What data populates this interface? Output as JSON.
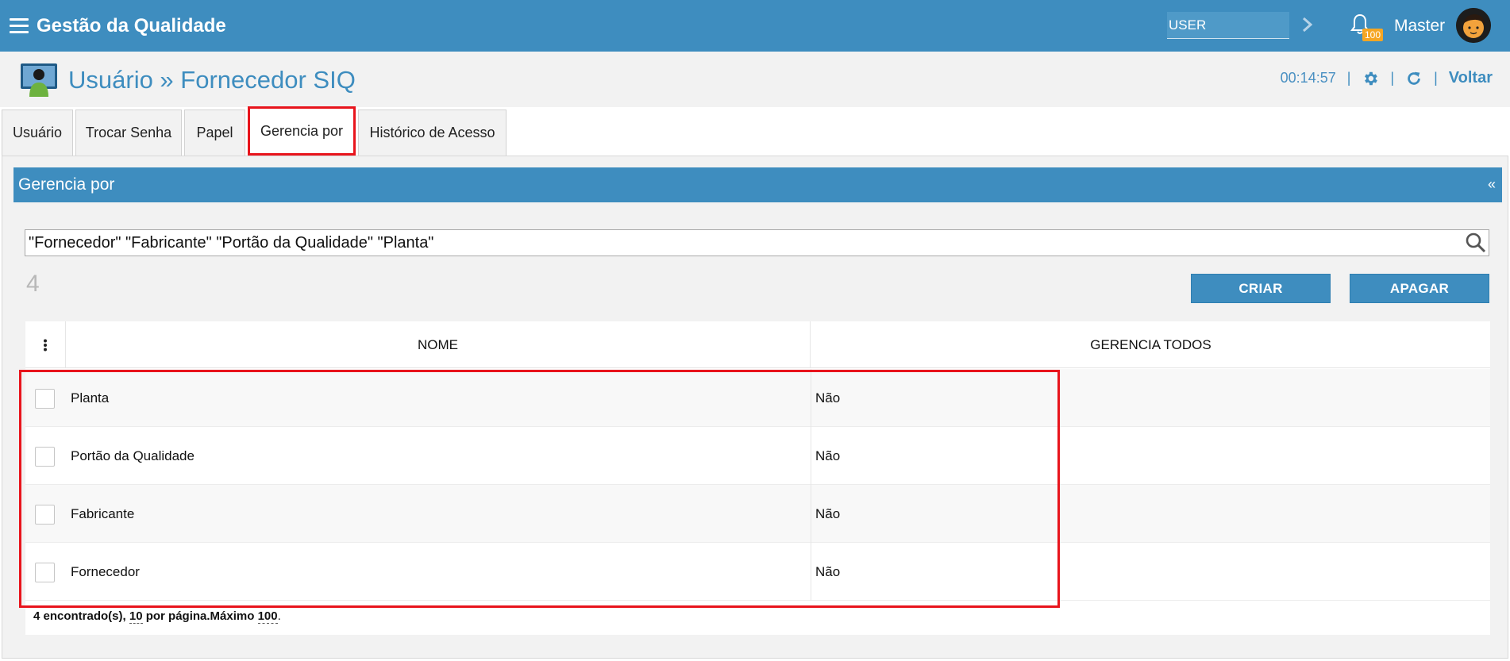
{
  "topbar": {
    "title": "Gestão da Qualidade",
    "user_search_placeholder": "USER",
    "notification_count": "100",
    "user_name": "Master"
  },
  "header": {
    "title": "Usuário » Fornecedor SIQ",
    "timer": "00:14:57",
    "back_label": "Voltar",
    "separator": "|"
  },
  "tabs": [
    {
      "label": "Usuário"
    },
    {
      "label": "Trocar Senha"
    },
    {
      "label": "Papel"
    },
    {
      "label": "Gerencia por",
      "active": true
    },
    {
      "label": "Histórico de Acesso"
    }
  ],
  "panel": {
    "title": "Gerencia por",
    "collapse_glyph": "«",
    "search_value": "\"Fornecedor\" \"Fabricante\" \"Portão da Qualidade\" \"Planta\"",
    "count": "4",
    "create_label": "CRIAR",
    "delete_label": "APAGAR"
  },
  "table": {
    "columns": [
      "NOME",
      "GERENCIA TODOS"
    ],
    "rows": [
      {
        "nome": "Planta",
        "gerencia": "Não"
      },
      {
        "nome": "Portão da Qualidade",
        "gerencia": "Não"
      },
      {
        "nome": "Fabricante",
        "gerencia": "Não"
      },
      {
        "nome": "Fornecedor",
        "gerencia": "Não"
      }
    ],
    "footer": {
      "found": "4 encontrado(s), ",
      "per_page_value": "10",
      "per_page_text": " por página.Máximo ",
      "max_value": "100",
      "end": "."
    }
  },
  "colors": {
    "brand_blue": "#3e8dbf",
    "highlight_red": "#e8141c",
    "badge_orange": "#f5a623"
  }
}
